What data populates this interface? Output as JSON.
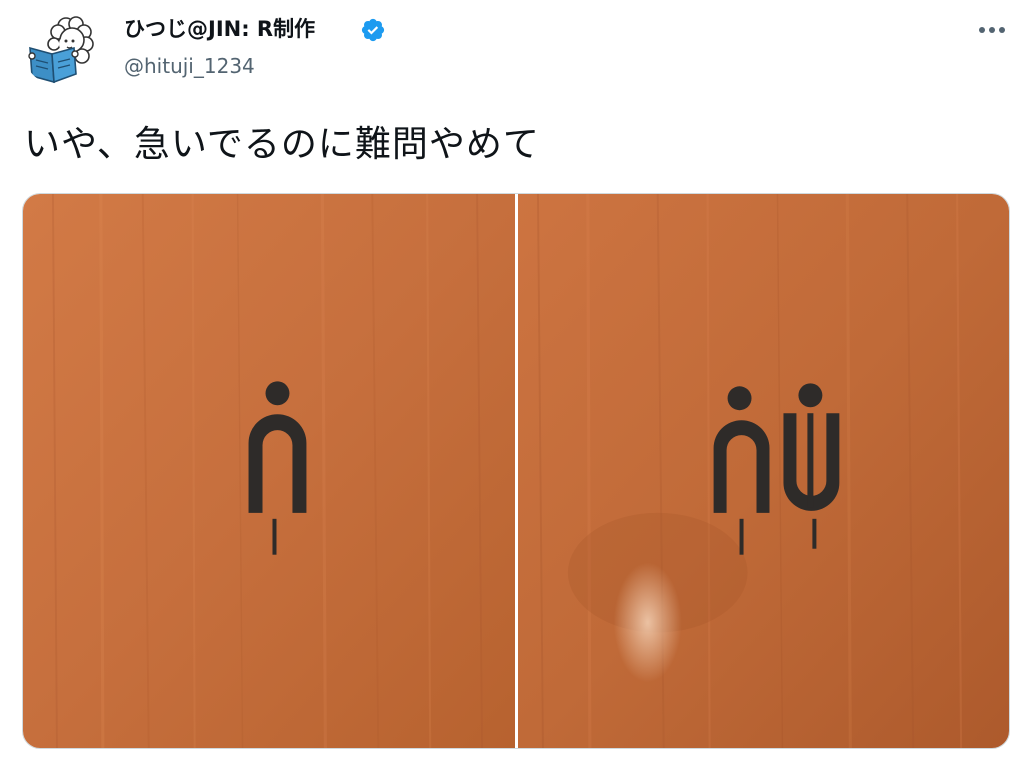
{
  "author": {
    "display_name": "ひつじ@JIN: R制作",
    "handle": "@hituji_1234",
    "verified": true,
    "avatar_icon": "sheep-reading-book-icon",
    "verified_icon": "verified-badge-icon"
  },
  "header": {
    "more_icon": "more-options-icon"
  },
  "tweet": {
    "text": "いや、急いでるのに難問やめて"
  },
  "media": {
    "photos": [
      {
        "icon_name": "restroom-sign-single-figure",
        "figure_count": 1
      },
      {
        "icon_name": "restroom-sign-two-figures",
        "figure_count": 2
      }
    ]
  },
  "colors": {
    "text_primary": "#0f1419",
    "text_secondary": "#536471",
    "verified_blue": "#1d9bf0",
    "wood": "#c9713f",
    "sign_ink": "#2e2b29"
  }
}
